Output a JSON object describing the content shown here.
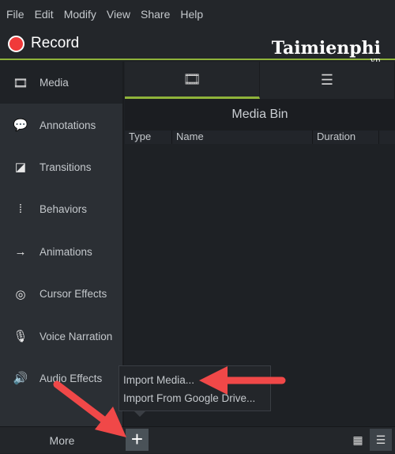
{
  "menu": [
    "File",
    "Edit",
    "Modify",
    "View",
    "Share",
    "Help"
  ],
  "record": {
    "label": "Record",
    "color": "#f03a3a"
  },
  "watermark": {
    "text": "Taimienphi",
    "suffix": ".vn"
  },
  "sidebar": {
    "items": [
      {
        "label": "Media",
        "icon": "film-icon"
      },
      {
        "label": "Annotations",
        "icon": "annotation-icon"
      },
      {
        "label": "Transitions",
        "icon": "transition-icon"
      },
      {
        "label": "Behaviors",
        "icon": "behaviors-icon"
      },
      {
        "label": "Animations",
        "icon": "animation-icon"
      },
      {
        "label": "Cursor Effects",
        "icon": "cursor-icon"
      },
      {
        "label": "Voice Narration",
        "icon": "microphone-icon"
      },
      {
        "label": "Audio Effects",
        "icon": "speaker-icon"
      }
    ],
    "more": "More"
  },
  "main": {
    "tabs": [
      {
        "icon": "film-icon",
        "active": true
      },
      {
        "icon": "library-list-icon"
      }
    ],
    "title": "Media Bin",
    "columns": [
      "Type",
      "Name",
      "Duration"
    ]
  },
  "popup": {
    "items": [
      "Import Media...",
      "Import From Google Drive..."
    ]
  },
  "accent": "#8fb33a",
  "annotation_arrow_color": "#f04848"
}
